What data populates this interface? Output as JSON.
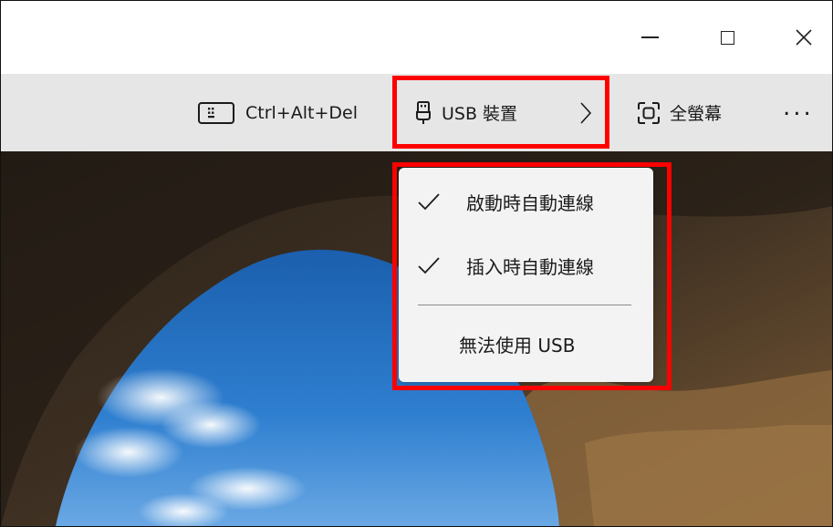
{
  "window_controls": {
    "minimize": "minimize-icon",
    "maximize": "maximize-icon",
    "close": "close-icon"
  },
  "toolbar": {
    "ctrl_alt_del_label": "Ctrl+Alt+Del",
    "usb_label": "USB 裝置",
    "fullscreen_label": "全螢幕",
    "more_label": "..."
  },
  "usb_menu": {
    "items": [
      {
        "label": "啟動時自動連線",
        "checked": true
      },
      {
        "label": "插入時自動連線",
        "checked": true
      },
      {
        "label": "無法使用 USB",
        "checked": false
      }
    ]
  },
  "colors": {
    "toolbar_bg": "#e6e6e6",
    "menu_bg": "#f3f3f3",
    "highlight": "#ff0000"
  }
}
